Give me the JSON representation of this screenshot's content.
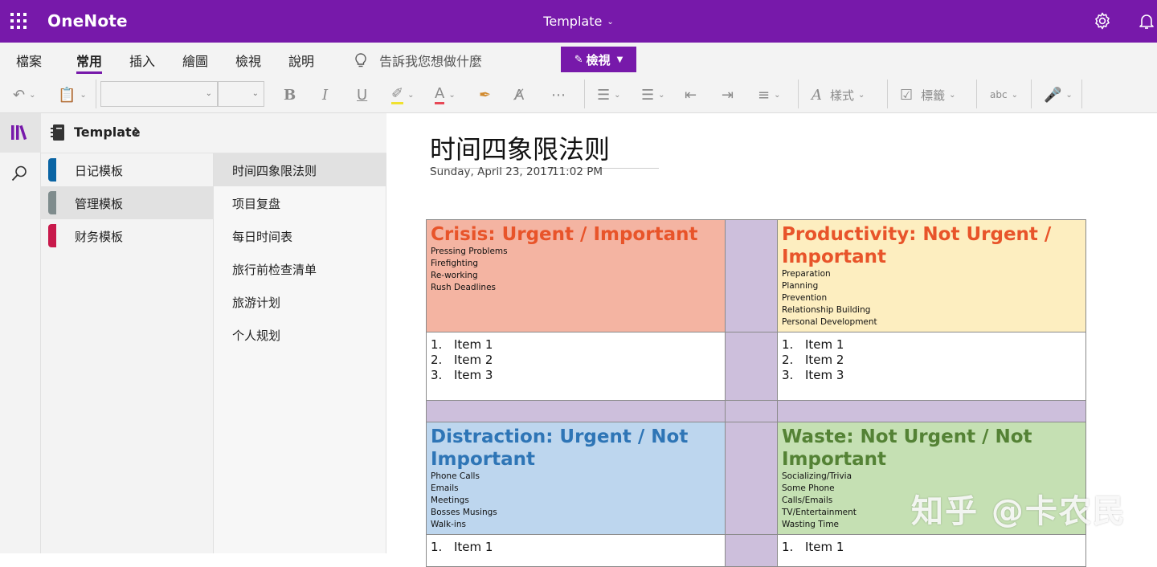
{
  "titlebar": {
    "app_name": "OneNote",
    "doc_title": "Template",
    "bg": "#7719aa"
  },
  "ribbon": {
    "tabs": [
      "檔案",
      "常用",
      "插入",
      "繪圖",
      "檢視",
      "說明"
    ],
    "active_tab": "常用",
    "tell_me": "告訴我您想做什麼",
    "view_button": "檢視"
  },
  "toolbar": {
    "styles_label": "樣式",
    "tags_label": "標籤",
    "spell_label": "abc"
  },
  "notebook": {
    "title": "Template"
  },
  "sections": [
    {
      "label": "日记模板",
      "color": "#0a64a4"
    },
    {
      "label": "管理模板",
      "color": "#7f8c8d"
    },
    {
      "label": "财务模板",
      "color": "#c8194b"
    }
  ],
  "pages": [
    "时间四象限法则",
    "项目复盘",
    "每日时间表",
    "旅行前检查清单",
    "旅游计划",
    "个人规划"
  ],
  "page": {
    "title": "时间四象限法则",
    "date": "Sunday, April 23, 2017",
    "time": "11:02 PM",
    "quadrants": {
      "crisis": {
        "heading": "Crisis: Urgent / Important",
        "color": "#e8542a",
        "bg": "#f4b4a2",
        "details": [
          "Pressing Problems",
          "Firefighting",
          "Re-working",
          "Rush Deadlines"
        ]
      },
      "productivity": {
        "heading": "Productivity: Not Urgent / Important",
        "color": "#e8542a",
        "bg": "#fdeec0",
        "details": [
          "Preparation",
          "Planning",
          "Prevention",
          "Relationship Building",
          "Personal Development"
        ]
      },
      "distraction": {
        "heading": "Distraction: Urgent / Not Important",
        "color": "#2e75b6",
        "bg": "#bdd6ee",
        "details": [
          "Phone Calls",
          "Emails",
          "Meetings",
          "Bosses Musings",
          "Walk-ins"
        ]
      },
      "waste": {
        "heading": "Waste: Not Urgent / Not Important",
        "color": "#548235",
        "bg": "#c5e0b3",
        "details": [
          "Socializing/Trivia",
          "Some Phone",
          "Calls/Emails",
          "TV/Entertainment",
          "Wasting Time"
        ]
      }
    },
    "items": [
      {
        "num": "1.",
        "text": "Item 1"
      },
      {
        "num": "2.",
        "text": "Item 2"
      },
      {
        "num": "3.",
        "text": "Item 3"
      }
    ],
    "spacer_color": "#cdbfdc"
  },
  "watermark": "知乎 @卡农民"
}
